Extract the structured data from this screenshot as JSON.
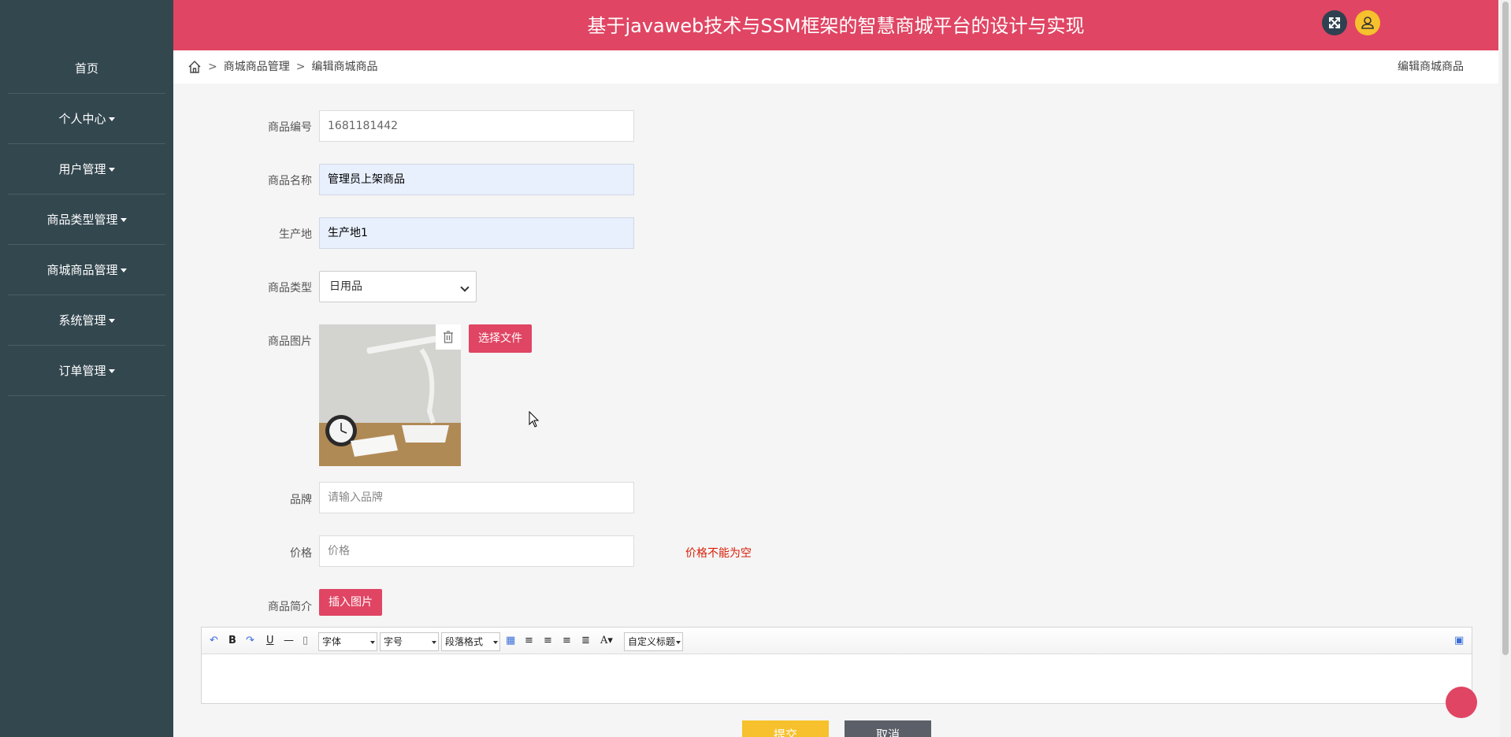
{
  "header": {
    "title": "基于javaweb技术与SSM框架的智慧商城平台的设计与实现"
  },
  "sidebar": {
    "items": [
      {
        "label": "首页",
        "has_caret": false
      },
      {
        "label": "个人中心",
        "has_caret": true
      },
      {
        "label": "用户管理",
        "has_caret": true
      },
      {
        "label": "商品类型管理",
        "has_caret": true
      },
      {
        "label": "商城商品管理",
        "has_caret": true
      },
      {
        "label": "系统管理",
        "has_caret": true
      },
      {
        "label": "订单管理",
        "has_caret": true
      }
    ]
  },
  "breadcrumb": {
    "items": [
      "商城商品管理",
      "编辑商城商品"
    ],
    "separator": ">",
    "page_title_right": "编辑商城商品"
  },
  "form": {
    "product_no": {
      "label": "商品编号",
      "value": "1681181442"
    },
    "product_name": {
      "label": "商品名称",
      "value": "管理员上架商品"
    },
    "origin": {
      "label": "生产地",
      "value": "生产地1"
    },
    "product_type": {
      "label": "商品类型",
      "value": "日用品"
    },
    "image": {
      "label": "商品图片",
      "choose_label": "选择文件"
    },
    "brand": {
      "label": "品牌",
      "placeholder": "请输入品牌"
    },
    "price": {
      "label": "价格",
      "placeholder": "价格",
      "error": "价格不能为空"
    },
    "description": {
      "label": "商品简介",
      "insert_image_label": "插入图片"
    }
  },
  "editor": {
    "font_family": "字体",
    "font_size": "字号",
    "paragraph": "段落格式",
    "custom_heading": "自定义标题"
  },
  "actions": {
    "submit": "提交",
    "cancel": "取消"
  },
  "colors": {
    "brand": "#e04563",
    "sidebar": "#33474f",
    "submit": "#f6c12c",
    "cancel": "#5b5f68",
    "error": "#d81e06"
  }
}
